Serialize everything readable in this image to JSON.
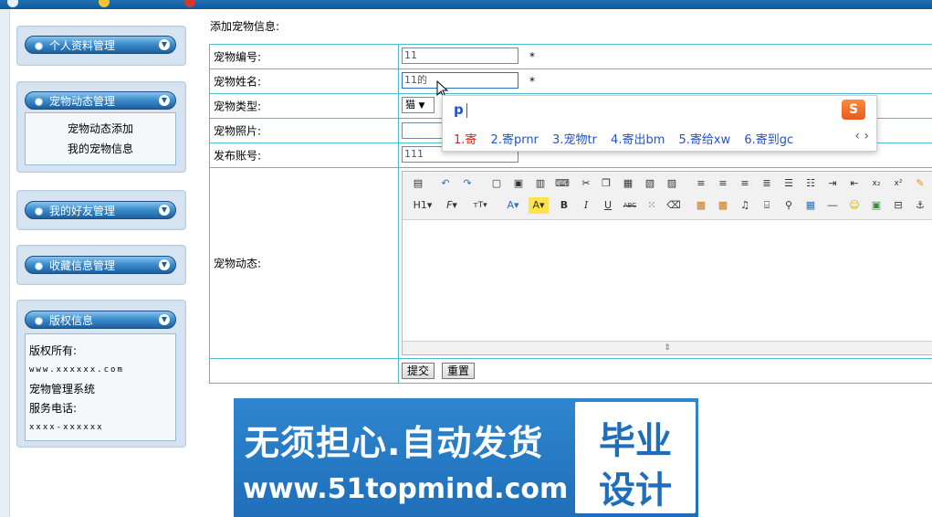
{
  "form_title": "添加宠物信息:",
  "sidebar": {
    "menus": [
      {
        "label": "个人资料管理"
      },
      {
        "label": "宠物动态管理",
        "links": [
          "宠物动态添加",
          "我的宠物信息"
        ]
      },
      {
        "label": "我的好友管理"
      },
      {
        "label": "收藏信息管理"
      },
      {
        "label": "版权信息"
      }
    ],
    "copyright": {
      "owner_label": "版权所有:",
      "website": "www.xxxxxx.com",
      "system_name": "宠物管理系统",
      "phone_label": "服务电话:",
      "phone": "xxxx-xxxxxx"
    }
  },
  "fields": {
    "pet_id": {
      "label": "宠物编号:",
      "value": "11"
    },
    "pet_name": {
      "label": "宠物姓名:",
      "value": "11的"
    },
    "pet_type": {
      "label": "宠物类型:",
      "value": "猫"
    },
    "pet_photo": {
      "label": "宠物照片:"
    },
    "account": {
      "label": "发布账号:",
      "value": "111"
    },
    "news": {
      "label": "宠物动态:"
    }
  },
  "required_mark": "*",
  "buttons": {
    "submit": "提交",
    "reset": "重置"
  },
  "ime": {
    "pinyin": "p",
    "candidates": [
      "1.寄",
      "2.寄prnr",
      "3.宠物tr",
      "4.寄出bm",
      "5.寄给xw",
      "6.寄到gc"
    ]
  },
  "ad": {
    "line1": "无须担心.自动发货",
    "line2": "www.51topmind.com",
    "stamp1": "毕业",
    "stamp2": "设计"
  }
}
